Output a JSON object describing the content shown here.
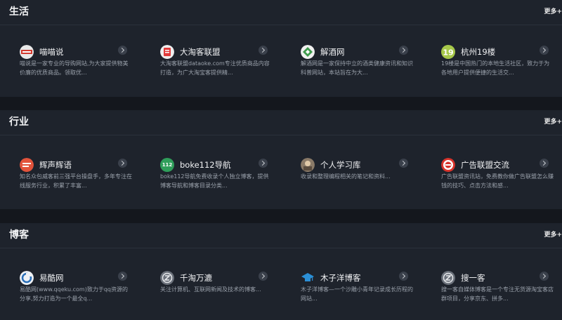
{
  "sections": [
    {
      "title": "生活",
      "more": "更多+",
      "cards": [
        {
          "name": "喵喵说",
          "desc": "喵说是一家专业的导购网站,为大家提供物美价廉的优质商品。领取优...",
          "icon": "miaomiao-logo-icon"
        },
        {
          "name": "大淘客联盟",
          "desc": "大淘客联盟dataoke.com专注优质商品内容打造，为广大淘宝客提供精...",
          "icon": "dataoke-logo-icon"
        },
        {
          "name": "解酒网",
          "desc": "解酒网是一家保持中立的酒类健康资讯和知识科普网站，本站旨在为大...",
          "icon": "jiejiu-logo-icon"
        },
        {
          "name": "杭州19楼",
          "desc": "19楼是中国热门的本地生活社区，致力于为各地用户提供便捷的生活交...",
          "icon": "19lou-logo-icon"
        }
      ]
    },
    {
      "title": "行业",
      "more": "更多+",
      "cards": [
        {
          "name": "辉声辉语",
          "desc": "知名众包威客前三强平台操盘手，多年专注在线服务行业，积累了丰富...",
          "icon": "huisheng-logo-icon"
        },
        {
          "name": "boke112导航",
          "desc": "boke112导航免费收录个人独立博客，提供博客导航和博客目录分类...",
          "icon": "boke112-logo-icon",
          "badge": "112"
        },
        {
          "name": "个人学习库",
          "desc": "收录和整理编程相关的笔记和资料...",
          "icon": "xuexiku-logo-icon"
        },
        {
          "name": "广告联盟交流",
          "desc": "广告联盟资讯站，免费教你做广告联盟怎么赚钱的技巧、点击方法和感...",
          "icon": "ad-union-logo-icon"
        }
      ]
    },
    {
      "title": "博客",
      "more": "更多+",
      "cards": [
        {
          "name": "易酷网",
          "desc": "易酷网(www.qqeku.com)致力于qq资源的分享,努力打造为一个最全q...",
          "icon": "qqeku-logo-icon"
        },
        {
          "name": "千淘万漉",
          "desc": "关注计算机、互联网新闻及技术的博客...",
          "icon": "qiantao-logo-icon"
        },
        {
          "name": "木子洋博客",
          "desc": "木子洋博客—一个沙雕小青年记录成长历程的网站...",
          "icon": "muziyang-logo-icon"
        },
        {
          "name": "搜一客",
          "desc": "搜一客自媒体博客是一个专注无货源淘宝客店群项目，分享京东、拼多...",
          "icon": "souyike-logo-icon"
        }
      ]
    }
  ]
}
